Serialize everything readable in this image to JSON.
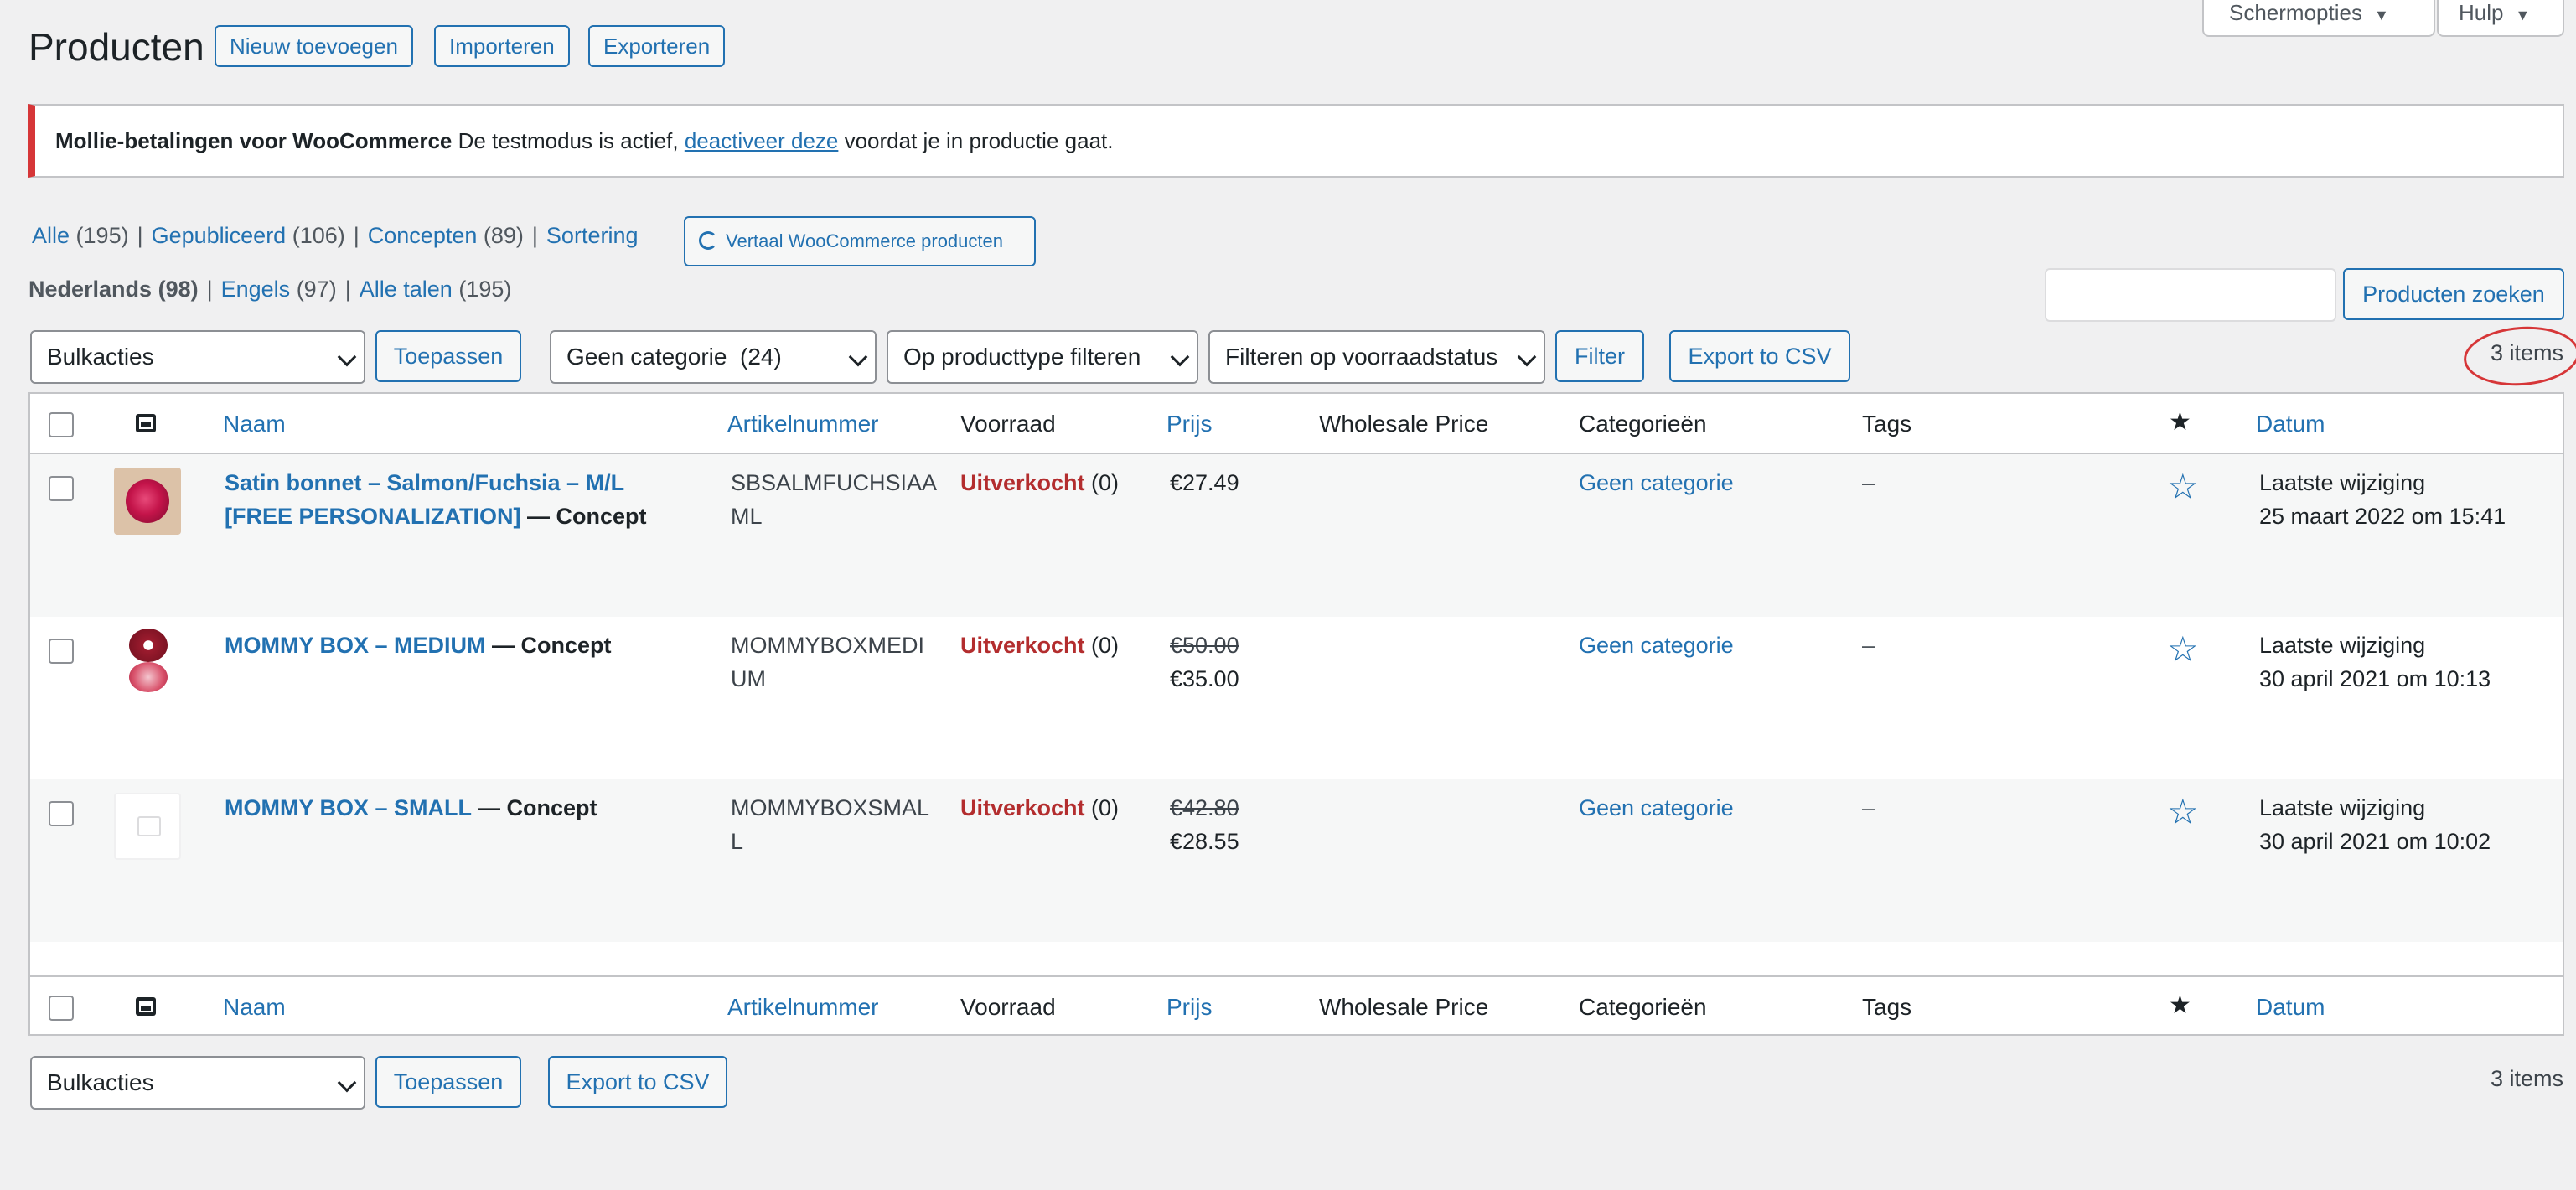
{
  "header": {
    "title": "Producten",
    "add_new": "Nieuw toevoegen",
    "import": "Importeren",
    "export": "Exporteren",
    "screen_options": "Schermopties",
    "help": "Hulp"
  },
  "notice": {
    "bold": "Mollie-betalingen voor WooCommerce",
    "text1": " De testmodus is actief, ",
    "link": "deactiveer deze",
    "text2": " voordat je in productie gaat."
  },
  "views": [
    {
      "label": "Alle",
      "count": "(195)"
    },
    {
      "label": "Gepubliceerd",
      "count": "(106)"
    },
    {
      "label": "Concepten",
      "count": "(89)"
    },
    {
      "label": "Sortering",
      "count": ""
    }
  ],
  "translate_button": "Vertaal WooCommerce producten",
  "languages": [
    {
      "label": "Nederlands",
      "count": "(98)"
    },
    {
      "label": "Engels",
      "count": "(97)"
    },
    {
      "label": "Alle talen",
      "count": "(195)"
    }
  ],
  "search": {
    "value": "",
    "button": "Producten zoeken"
  },
  "filters": {
    "bulk": "Bulkacties",
    "apply": "Toepassen",
    "category": "Geen categorie  (24)",
    "product_type": "Op producttype filteren",
    "stock_status": "Filteren op voorraadstatus",
    "filter_btn": "Filter",
    "export_csv": "Export to CSV",
    "items_count": "3 items"
  },
  "columns": {
    "name": "Naam",
    "sku": "Artikelnummer",
    "stock": "Voorraad",
    "price": "Prijs",
    "wholesale": "Wholesale Price",
    "categories": "Categorieën",
    "tags": "Tags",
    "date": "Datum"
  },
  "rows": [
    {
      "name_line1": "Satin bonnet – Salmon/Fuchsia – M/L",
      "name_line2": "[FREE PERSONALIZATION]",
      "status": " — Concept",
      "sku_line1": "SBSALMFUCHSIAA",
      "sku_line2": "ML",
      "stock": "Uitverkocht",
      "stock_count": " (0)",
      "price_old": "",
      "price": "€27.49",
      "category": "Geen categorie",
      "tags": "–",
      "date_label": "Laatste wijziging",
      "date": "25 maart 2022 om 15:41"
    },
    {
      "name_line1": "MOMMY BOX – MEDIUM",
      "name_line2": "",
      "status": " — Concept",
      "sku_line1": "MOMMYBOXMEDI",
      "sku_line2": "UM",
      "stock": "Uitverkocht",
      "stock_count": " (0)",
      "price_old": "€50.00",
      "price": "€35.00",
      "category": "Geen categorie",
      "tags": "–",
      "date_label": "Laatste wijziging",
      "date": "30 april 2021 om 10:13"
    },
    {
      "name_line1": "MOMMY BOX – SMALL",
      "name_line2": "",
      "status": " — Concept",
      "sku_line1": "MOMMYBOXSMAL",
      "sku_line2": "L",
      "stock": "Uitverkocht",
      "stock_count": " (0)",
      "price_old": "€42.80",
      "price": "€28.55",
      "category": "Geen categorie",
      "tags": "–",
      "date_label": "Laatste wijziging",
      "date": "30 april 2021 om 10:02"
    }
  ],
  "icons": {
    "star_filled": "★",
    "star_outline": "☆"
  }
}
